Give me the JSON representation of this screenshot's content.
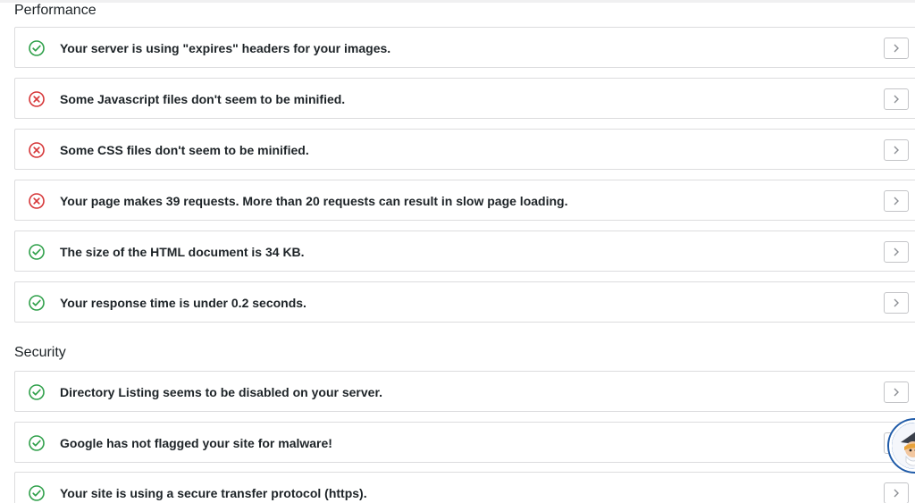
{
  "colors": {
    "pass": "#2fa04a",
    "fail": "#d63638",
    "border": "#dcdcde"
  },
  "sections": {
    "performance": {
      "title": "Performance",
      "items": [
        {
          "status": "pass",
          "icon": "check-circle-icon",
          "text": "Your server is using \"expires\" headers for your images."
        },
        {
          "status": "fail",
          "icon": "x-circle-icon",
          "text": "Some Javascript files don't seem to be minified."
        },
        {
          "status": "fail",
          "icon": "x-circle-icon",
          "text": "Some CSS files don't seem to be minified."
        },
        {
          "status": "fail",
          "icon": "x-circle-icon",
          "text": "Your page makes 39 requests. More than 20 requests can result in slow page loading."
        },
        {
          "status": "pass",
          "icon": "check-circle-icon",
          "text": "The size of the HTML document is 34 KB."
        },
        {
          "status": "pass",
          "icon": "check-circle-icon",
          "text": "Your response time is under 0.2 seconds."
        }
      ]
    },
    "security": {
      "title": "Security",
      "items": [
        {
          "status": "pass",
          "icon": "check-circle-icon",
          "text": "Directory Listing seems to be disabled on your server."
        },
        {
          "status": "pass",
          "icon": "check-circle-icon",
          "text": "Google has not flagged your site for malware!"
        },
        {
          "status": "pass",
          "icon": "check-circle-icon",
          "text": "Your site is using a secure transfer protocol (https)."
        }
      ]
    }
  },
  "row_action_icon": "chevron-right-icon",
  "help_widget_icon": "wizard-avatar-icon"
}
